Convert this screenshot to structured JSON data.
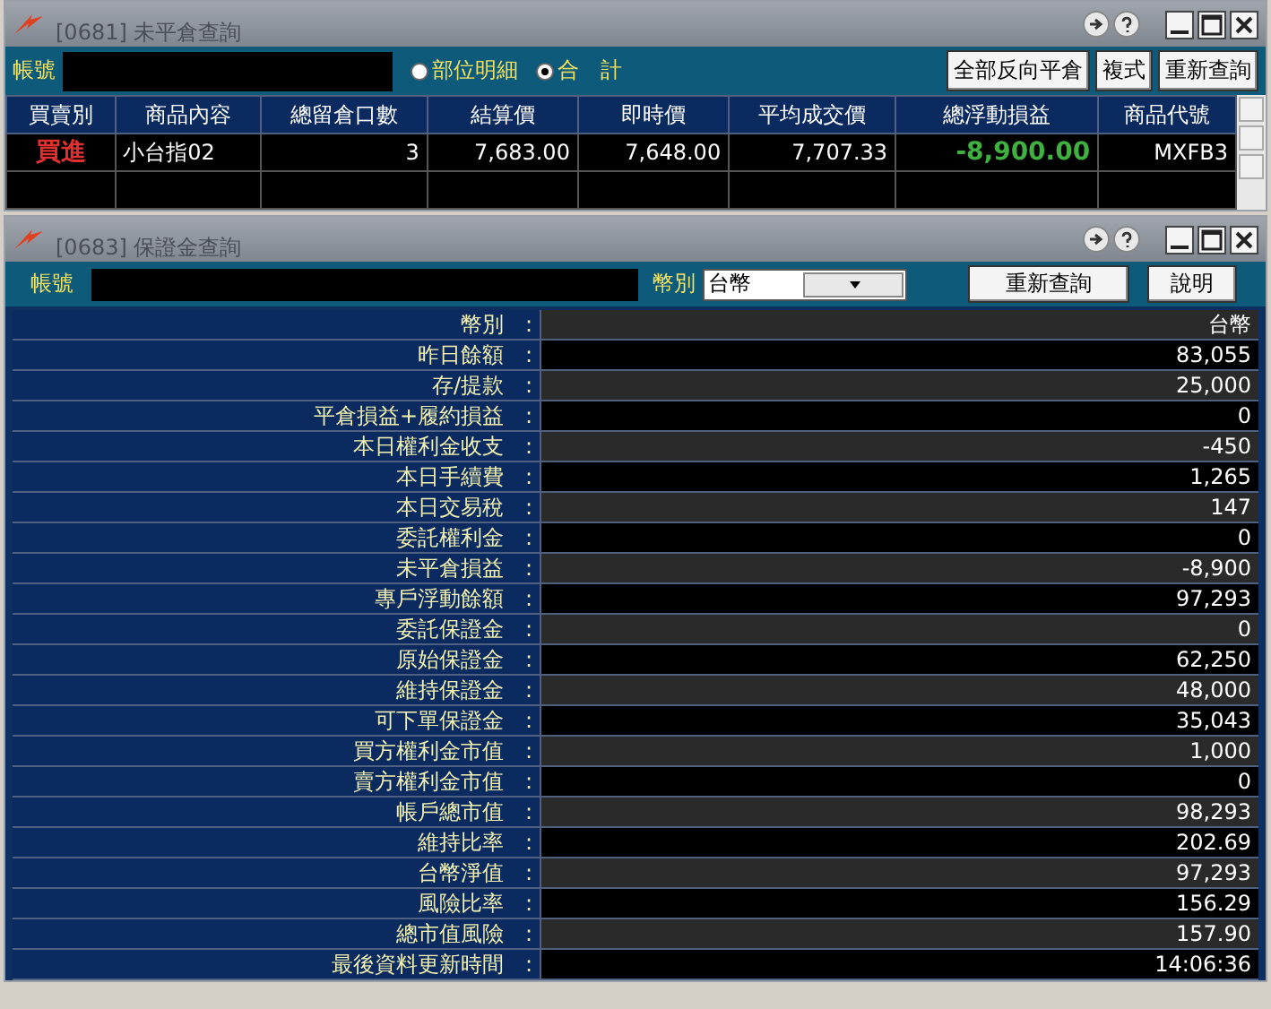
{
  "positions_window": {
    "title": "[0681] 未平倉查詢",
    "toolbar": {
      "account_label": "帳號",
      "radios": [
        {
          "label": "部位明細",
          "selected": false
        },
        {
          "label": "合　計",
          "selected": true
        }
      ],
      "buttons": [
        "全部反向平倉",
        "複式",
        "重新查詢"
      ]
    },
    "table": {
      "columns": [
        "買賣別",
        "商品內容",
        "總留倉口數",
        "結算價",
        "即時價",
        "平均成交價",
        "總浮動損益",
        "商品代號"
      ],
      "rows": [
        {
          "cells": [
            {
              "text": "買進",
              "color": "#e03030"
            },
            {
              "text": "小台指02"
            },
            {
              "text": "3"
            },
            {
              "text": "7,683.00"
            },
            {
              "text": "7,648.00"
            },
            {
              "text": "7,707.33"
            },
            {
              "text": "-8,900.00",
              "color": "#40b040"
            },
            {
              "text": "MXFB3"
            }
          ]
        }
      ]
    }
  },
  "margin_window": {
    "title": "[0683] 保證金查詢",
    "toolbar": {
      "account_label": "帳號",
      "currency_label": "幣別",
      "currency": "台幣",
      "buttons": [
        "重新查詢",
        "說明"
      ]
    },
    "rows": [
      {
        "label": "幣別",
        "sep": ":",
        "value": "台幣"
      },
      {
        "label": "昨日餘額",
        "sep": ":",
        "value": "83,055"
      },
      {
        "label": "存/提款",
        "sep": ":",
        "value": "25,000"
      },
      {
        "label": "平倉損益+履約損益",
        "sep": ":",
        "value": "0"
      },
      {
        "label": "本日權利金收支",
        "sep": ":",
        "value": "-450"
      },
      {
        "label": "本日手續費",
        "sep": ":",
        "value": "1,265"
      },
      {
        "label": "本日交易稅",
        "sep": ":",
        "value": "147"
      },
      {
        "label": "委託權利金",
        "sep": ":",
        "value": "0"
      },
      {
        "label": "未平倉損益",
        "sep": ":",
        "value": "-8,900"
      },
      {
        "label": "專戶浮動餘額",
        "sep": ":",
        "value": "97,293"
      },
      {
        "label": "委託保證金",
        "sep": ":",
        "value": "0"
      },
      {
        "label": "原始保證金",
        "sep": ":",
        "value": "62,250"
      },
      {
        "label": "維持保證金",
        "sep": ":",
        "value": "48,000"
      },
      {
        "label": "可下單保證金",
        "sep": ":",
        "value": "35,043"
      },
      {
        "label": "買方權利金市值",
        "sep": ":",
        "value": "1,000"
      },
      {
        "label": "賣方權利金市值",
        "sep": ":",
        "value": "0"
      },
      {
        "label": "帳戶總市值",
        "sep": ":",
        "value": "98,293"
      },
      {
        "label": "維持比率",
        "sep": ":",
        "value": "202.69"
      },
      {
        "label": "台幣淨值",
        "sep": ":",
        "value": "97,293"
      },
      {
        "label": "風險比率",
        "sep": ":",
        "value": "156.29"
      },
      {
        "label": "總市值風險",
        "sep": ":",
        "value": "157.90"
      },
      {
        "label": "最後資料更新時間",
        "sep": ":",
        "value": "14:06:36"
      }
    ]
  }
}
